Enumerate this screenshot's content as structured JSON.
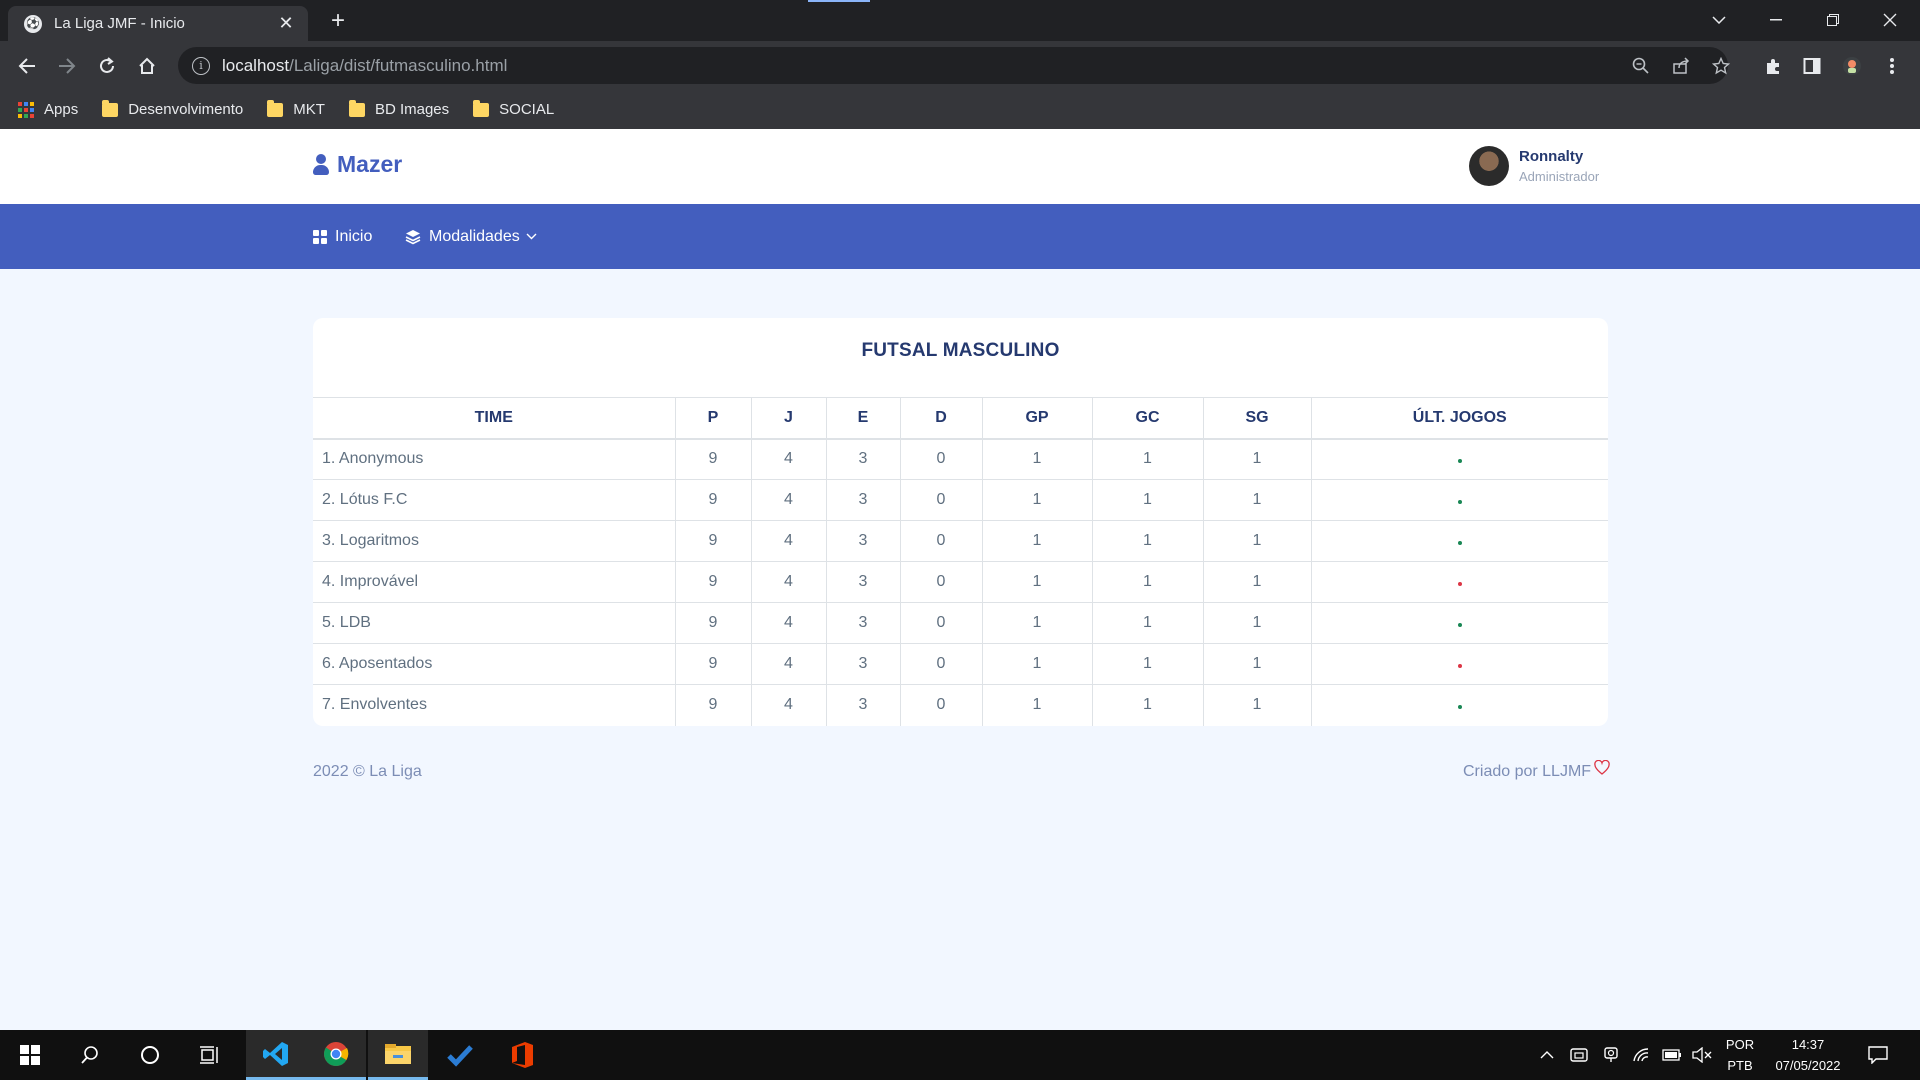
{
  "browser": {
    "tab_title": "La Liga JMF - Inicio",
    "url_host": "localhost",
    "url_path": "/Laliga/dist/futmasculino.html",
    "bookmarks": [
      {
        "label": "Apps",
        "icon": "apps-grid-icon"
      },
      {
        "label": "Desenvolvimento",
        "icon": "folder-icon"
      },
      {
        "label": "MKT",
        "icon": "folder-icon"
      },
      {
        "label": "BD Images",
        "icon": "folder-icon"
      },
      {
        "label": "SOCIAL",
        "icon": "folder-icon"
      }
    ]
  },
  "header": {
    "logo": "Mazer",
    "user_name": "Ronnalty",
    "user_role": "Administrador"
  },
  "nav": {
    "home": "Inicio",
    "modalities": "Modalidades"
  },
  "standings": {
    "title": "FUTSAL MASCULINO",
    "columns": [
      "TIME",
      "P",
      "J",
      "E",
      "D",
      "GP",
      "GC",
      "SG",
      "ÚLT. JOGOS"
    ],
    "rows": [
      {
        "team": "1. Anonymous",
        "p": "9",
        "j": "4",
        "e": "3",
        "d": "0",
        "gp": "1",
        "gc": "1",
        "sg": "1",
        "last": "win"
      },
      {
        "team": "2. Lótus F.C",
        "p": "9",
        "j": "4",
        "e": "3",
        "d": "0",
        "gp": "1",
        "gc": "1",
        "sg": "1",
        "last": "win"
      },
      {
        "team": "3. Logaritmos",
        "p": "9",
        "j": "4",
        "e": "3",
        "d": "0",
        "gp": "1",
        "gc": "1",
        "sg": "1",
        "last": "win"
      },
      {
        "team": "4. Improvável",
        "p": "9",
        "j": "4",
        "e": "3",
        "d": "0",
        "gp": "1",
        "gc": "1",
        "sg": "1",
        "last": "loss"
      },
      {
        "team": "5. LDB",
        "p": "9",
        "j": "4",
        "e": "3",
        "d": "0",
        "gp": "1",
        "gc": "1",
        "sg": "1",
        "last": "win"
      },
      {
        "team": "6. Aposentados",
        "p": "9",
        "j": "4",
        "e": "3",
        "d": "0",
        "gp": "1",
        "gc": "1",
        "sg": "1",
        "last": "loss"
      },
      {
        "team": "7. Envolventes",
        "p": "9",
        "j": "4",
        "e": "3",
        "d": "0",
        "gp": "1",
        "gc": "1",
        "sg": "1",
        "last": "win"
      }
    ]
  },
  "footer": {
    "left": "2022 © La Liga",
    "right": "Criado por LLJMF"
  },
  "taskbar": {
    "lang_top": "POR",
    "lang_bottom": "PTB",
    "time": "14:37",
    "date": "07/05/2022"
  },
  "colors": {
    "primary": "#435ebe",
    "win": "#198754",
    "loss": "#dc3545"
  }
}
